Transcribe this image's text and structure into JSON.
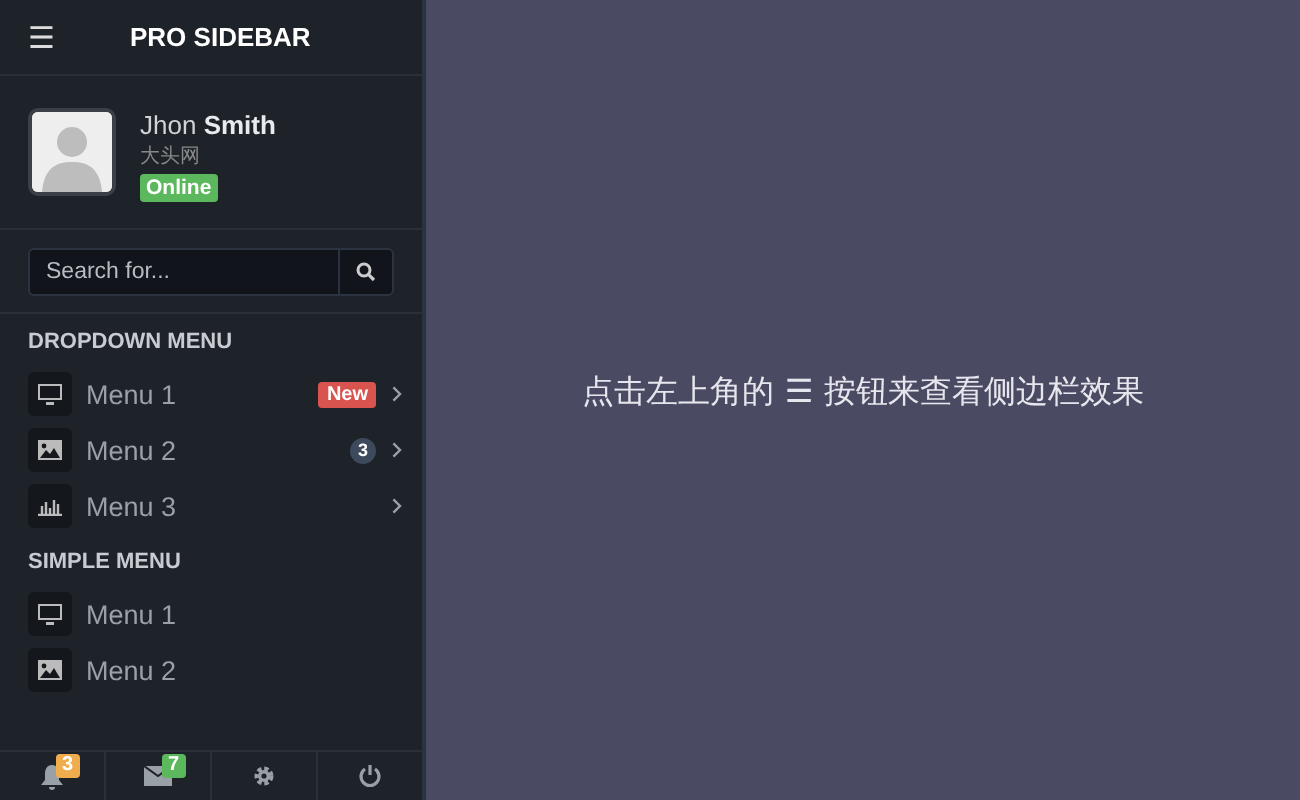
{
  "header": {
    "menu_glyph": "☰",
    "title": "PRO SIDEBAR"
  },
  "profile": {
    "name": "Jhon **Smith**",
    "subtitle": "大头网",
    "status": "Online"
  },
  "search": {
    "placeholder": "Search for..."
  },
  "sections": [
    {
      "title": "DROPDOWN MENU",
      "kind": "dropdown",
      "items": [
        {
          "label": "Menu 1",
          "badge": {
            "text": "New",
            "kind": "label",
            "color": "#d9534f"
          }
        },
        {
          "label": "Menu 2",
          "badge": {
            "text": "3",
            "kind": "pill",
            "color": "#3d4a5c"
          }
        },
        {
          "label": "Menu 3"
        }
      ]
    },
    {
      "title": "SIMPLE MENU",
      "kind": "simple",
      "items": [
        {
          "label": "Menu 1"
        },
        {
          "label": "Menu 2"
        }
      ]
    }
  ],
  "footer": [
    {
      "kind": "alerts",
      "badge": "3",
      "color": "#f0ad4e"
    },
    {
      "kind": "messages",
      "badge": "7",
      "color": "#5cb85c"
    },
    {
      "kind": "settings"
    },
    {
      "kind": "power"
    }
  ],
  "main": {
    "message": "点击左上角的 ☰ 按钮来查看侧边栏效果"
  }
}
